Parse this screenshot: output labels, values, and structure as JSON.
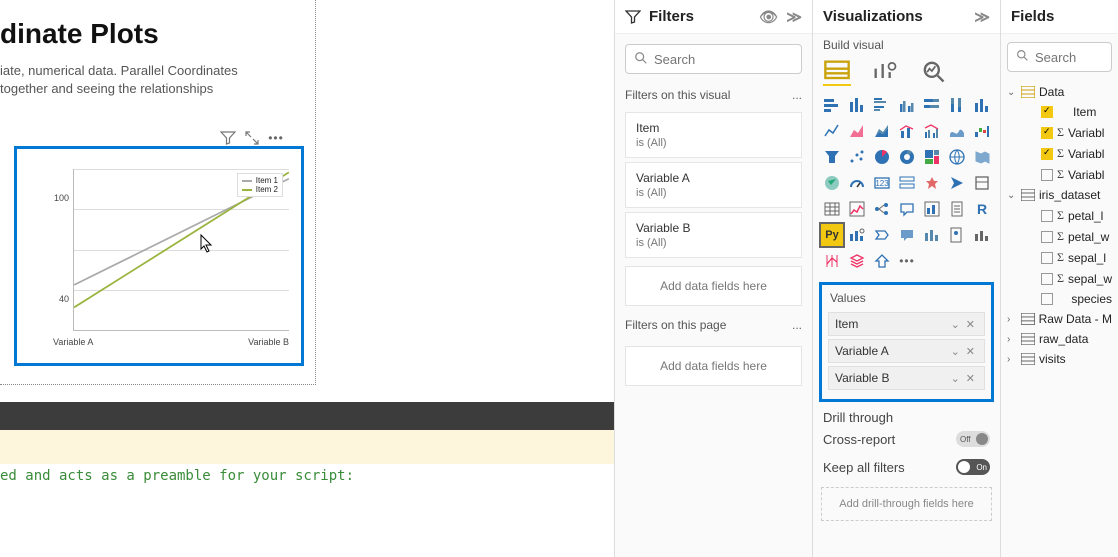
{
  "canvas": {
    "title": "dinate Plots",
    "subtitle_l1": "iate, numerical data. Parallel Coordinates",
    "subtitle_l2": "together and seeing the relationships"
  },
  "chart_data": {
    "type": "line",
    "title": "",
    "xlabel": "",
    "ylabel": "",
    "categories": [
      "Variable A",
      "Variable B"
    ],
    "ylim": [
      20,
      140
    ],
    "y_ticks": [
      40,
      100
    ],
    "series": [
      {
        "name": "Item 1",
        "color": "#aaaaaa",
        "values": [
          50,
          130
        ]
      },
      {
        "name": "Item 2",
        "color": "#9ab43e",
        "values": [
          36,
          138
        ]
      }
    ],
    "legend_labels": [
      "Item 1",
      "Item 2"
    ]
  },
  "dark_bar_icons": [
    "chevron-down",
    "arrow-out",
    "gear",
    "play"
  ],
  "script_line": "ed and acts as a preamble for your script:",
  "filters": {
    "title": "Filters",
    "search_placeholder": "Search",
    "section_visual": "Filters on this visual",
    "section_page": "Filters on this page",
    "cards": [
      {
        "name": "Item",
        "val": "is (All)"
      },
      {
        "name": "Variable A",
        "val": "is (All)"
      },
      {
        "name": "Variable B",
        "val": "is (All)"
      }
    ],
    "add_fields": "Add data fields here",
    "ellipsis": "..."
  },
  "viz": {
    "title": "Visualizations",
    "sub": "Build visual",
    "values_label": "Values",
    "pills": [
      "Item",
      "Variable A",
      "Variable B"
    ],
    "drill": "Drill through",
    "cross": "Cross-report",
    "keep": "Keep all filters",
    "off": "Off",
    "on": "On",
    "drill_ph": "Add drill-through fields here"
  },
  "fields": {
    "title": "Fields",
    "search_placeholder": "Search",
    "tables": [
      {
        "name": "Data",
        "expanded": true,
        "cols": [
          {
            "name": "Item",
            "checked": true,
            "sigma": false
          },
          {
            "name": "Variable A",
            "checked": true,
            "sigma": true,
            "clip": "Variabl"
          },
          {
            "name": "Variable B",
            "checked": true,
            "sigma": true,
            "clip": "Variabl"
          },
          {
            "name": "Variable C",
            "checked": false,
            "sigma": true,
            "clip": "Variabl"
          }
        ]
      },
      {
        "name": "iris_dataset",
        "expanded": true,
        "cols": [
          {
            "name": "petal_length",
            "checked": false,
            "sigma": true,
            "clip": "petal_l"
          },
          {
            "name": "petal_width",
            "checked": false,
            "sigma": true,
            "clip": "petal_w"
          },
          {
            "name": "sepal_length",
            "checked": false,
            "sigma": true,
            "clip": "sepal_l"
          },
          {
            "name": "sepal_width",
            "checked": false,
            "sigma": true,
            "clip": "sepal_w"
          },
          {
            "name": "species",
            "checked": false,
            "sigma": false,
            "clip": "species"
          }
        ]
      },
      {
        "name": "Raw Data - M",
        "expanded": false
      },
      {
        "name": "raw_data",
        "expanded": false
      },
      {
        "name": "visits",
        "expanded": false
      }
    ]
  }
}
